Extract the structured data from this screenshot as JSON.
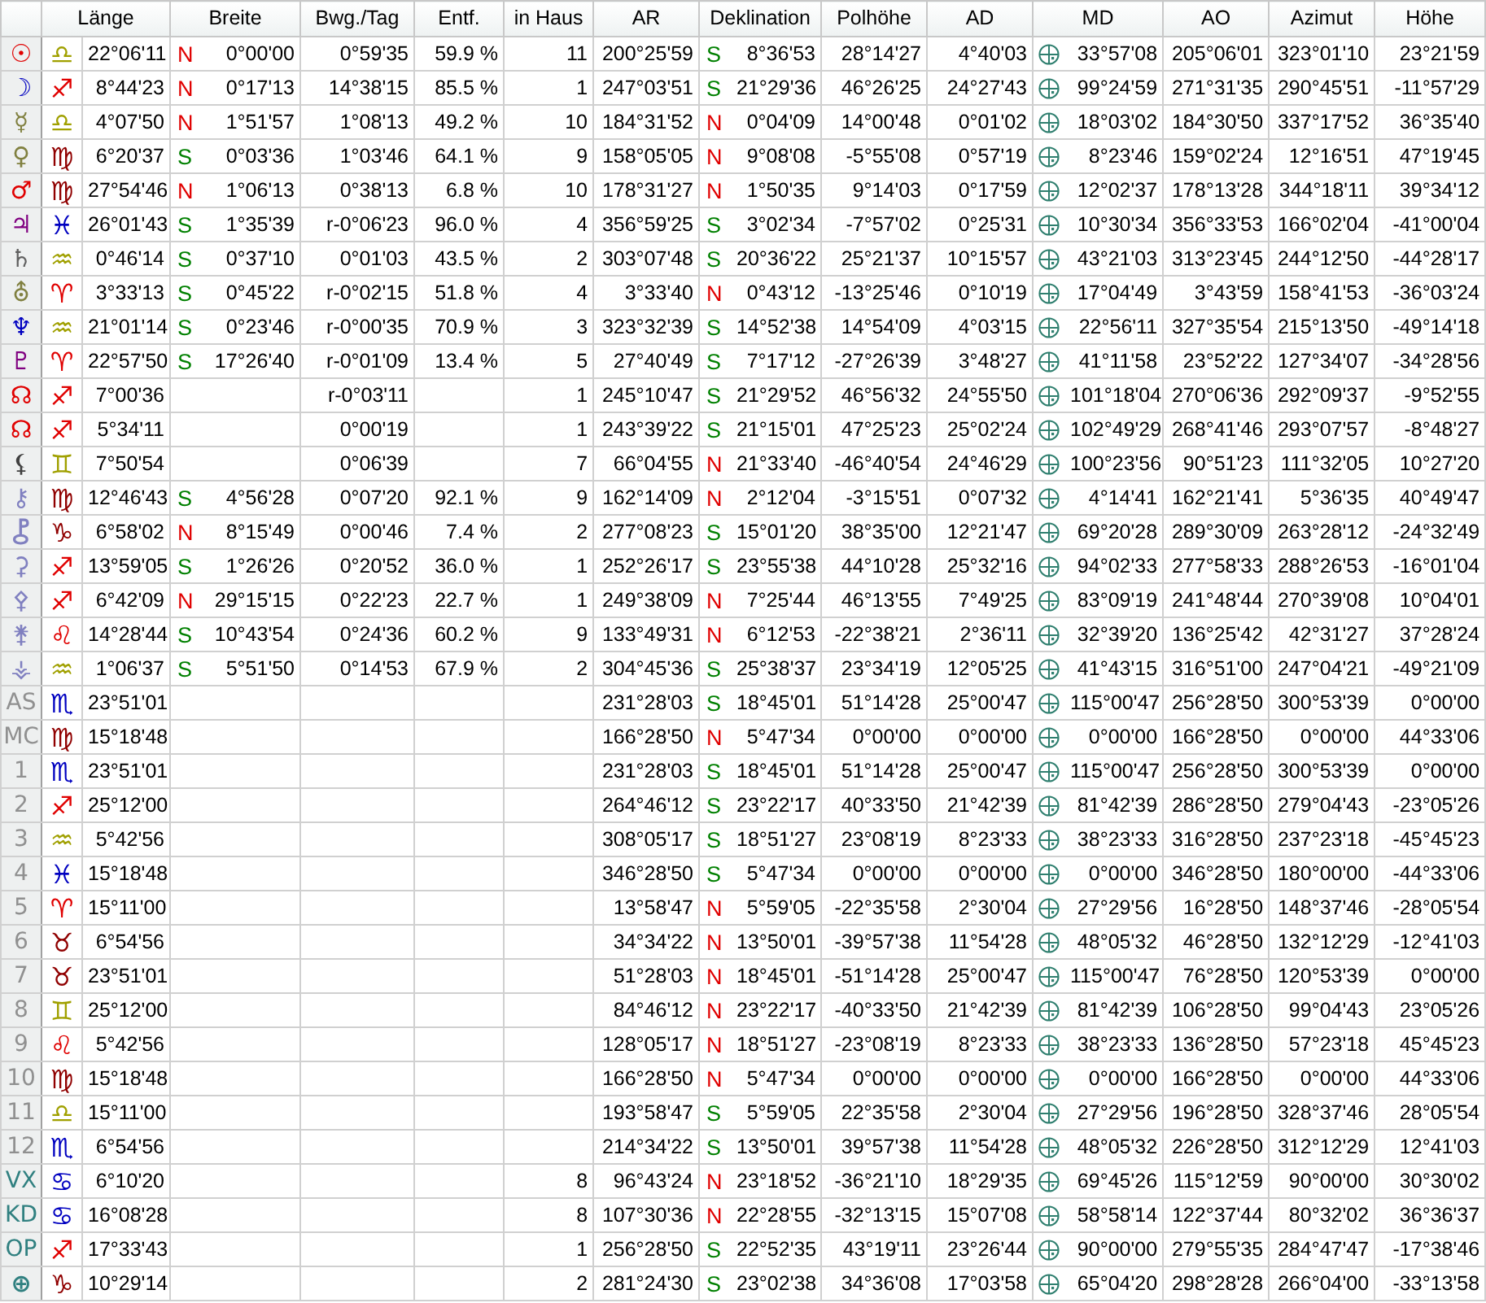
{
  "columns": [
    {
      "label": "Länge"
    },
    {
      "label": "Breite"
    },
    {
      "label": "Bwg./Tag"
    },
    {
      "label": "Entf."
    },
    {
      "label": "in Haus"
    },
    {
      "label": "AR"
    },
    {
      "label": "Deklination"
    },
    {
      "label": "Polhöhe"
    },
    {
      "label": "AD"
    },
    {
      "label": "MD"
    },
    {
      "label": "AO"
    },
    {
      "label": "Azimut"
    },
    {
      "label": "Höhe"
    }
  ],
  "rows": [
    {
      "body": {
        "text": "☉",
        "color": "#e00000"
      },
      "sign": {
        "text": "♎",
        "color": "#a0a000"
      },
      "laenge": "22°06'11",
      "breite": {
        "dir": "N",
        "color": "#e00000",
        "value": "0°00'00"
      },
      "bwg": "0°59'35",
      "entf": "59.9 %",
      "haus": "11",
      "ar": "200°25'59",
      "dekl": {
        "dir": "S",
        "color": "#008000",
        "value": "8°36'53"
      },
      "polhoehe": "28°14'27",
      "ad": "4°40'03",
      "md": "33°57'08",
      "ao": "205°06'01",
      "azimut": "323°01'10",
      "hoehe": "23°21'59"
    },
    {
      "body": {
        "text": "☽",
        "color": "#0000c0"
      },
      "sign": {
        "text": "♐",
        "color": "#e00000"
      },
      "laenge": "8°44'23",
      "breite": {
        "dir": "N",
        "color": "#e00000",
        "value": "0°17'13"
      },
      "bwg": "14°38'15",
      "entf": "85.5 %",
      "haus": "1",
      "ar": "247°03'51",
      "dekl": {
        "dir": "S",
        "color": "#008000",
        "value": "21°29'36"
      },
      "polhoehe": "46°26'25",
      "ad": "24°27'43",
      "md": "99°24'59",
      "ao": "271°31'35",
      "azimut": "290°45'51",
      "hoehe": "-11°57'29"
    },
    {
      "body": {
        "text": "☿",
        "color": "#808040"
      },
      "sign": {
        "text": "♎",
        "color": "#a0a000"
      },
      "laenge": "4°07'50",
      "breite": {
        "dir": "N",
        "color": "#e00000",
        "value": "1°51'57"
      },
      "bwg": "1°08'13",
      "entf": "49.2 %",
      "haus": "10",
      "ar": "184°31'52",
      "dekl": {
        "dir": "N",
        "color": "#e00000",
        "value": "0°04'09"
      },
      "polhoehe": "14°00'48",
      "ad": "0°01'02",
      "md": "18°03'02",
      "ao": "184°30'50",
      "azimut": "337°17'52",
      "hoehe": "36°35'40"
    },
    {
      "body": {
        "text": "♀",
        "color": "#808040"
      },
      "sign": {
        "text": "♍",
        "color": "#900000"
      },
      "laenge": "6°20'37",
      "breite": {
        "dir": "S",
        "color": "#008000",
        "value": "0°03'36"
      },
      "bwg": "1°03'46",
      "entf": "64.1 %",
      "haus": "9",
      "ar": "158°05'05",
      "dekl": {
        "dir": "N",
        "color": "#e00000",
        "value": "9°08'08"
      },
      "polhoehe": "-5°55'08",
      "ad": "0°57'19",
      "md": "8°23'46",
      "ao": "159°02'24",
      "azimut": "12°16'51",
      "hoehe": "47°19'45"
    },
    {
      "body": {
        "text": "♂",
        "color": "#e00000"
      },
      "sign": {
        "text": "♍",
        "color": "#900000"
      },
      "laenge": "27°54'46",
      "breite": {
        "dir": "N",
        "color": "#e00000",
        "value": "1°06'13"
      },
      "bwg": "0°38'13",
      "entf": "6.8 %",
      "haus": "10",
      "ar": "178°31'27",
      "dekl": {
        "dir": "N",
        "color": "#e00000",
        "value": "1°50'35"
      },
      "polhoehe": "9°14'03",
      "ad": "0°17'59",
      "md": "12°02'37",
      "ao": "178°13'28",
      "azimut": "344°18'11",
      "hoehe": "39°34'12"
    },
    {
      "body": {
        "text": "♃",
        "color": "#800080"
      },
      "sign": {
        "text": "♓",
        "color": "#0000c0"
      },
      "laenge": "26°01'43",
      "breite": {
        "dir": "S",
        "color": "#008000",
        "value": "1°35'39"
      },
      "bwg": "r-0°06'23",
      "entf": "96.0 %",
      "haus": "4",
      "ar": "356°59'25",
      "dekl": {
        "dir": "S",
        "color": "#008000",
        "value": "3°02'34"
      },
      "polhoehe": "-7°57'02",
      "ad": "0°25'31",
      "md": "10°30'34",
      "ao": "356°33'53",
      "azimut": "166°02'04",
      "hoehe": "-41°00'04"
    },
    {
      "body": {
        "text": "♄",
        "color": "#606060"
      },
      "sign": {
        "text": "♒",
        "color": "#a0a000"
      },
      "laenge": "0°46'14",
      "breite": {
        "dir": "S",
        "color": "#008000",
        "value": "0°37'10"
      },
      "bwg": "0°01'03",
      "entf": "43.5 %",
      "haus": "2",
      "ar": "303°07'48",
      "dekl": {
        "dir": "S",
        "color": "#008000",
        "value": "20°36'22"
      },
      "polhoehe": "25°21'37",
      "ad": "10°15'57",
      "md": "43°21'03",
      "ao": "313°23'45",
      "azimut": "244°12'50",
      "hoehe": "-44°28'17"
    },
    {
      "body": {
        "text": "⛢",
        "color": "#808040"
      },
      "sign": {
        "text": "♈",
        "color": "#e00000"
      },
      "laenge": "3°33'13",
      "breite": {
        "dir": "S",
        "color": "#008000",
        "value": "0°45'22"
      },
      "bwg": "r-0°02'15",
      "entf": "51.8 %",
      "haus": "4",
      "ar": "3°33'40",
      "dekl": {
        "dir": "N",
        "color": "#e00000",
        "value": "0°43'12"
      },
      "polhoehe": "-13°25'46",
      "ad": "0°10'19",
      "md": "17°04'49",
      "ao": "3°43'59",
      "azimut": "158°41'53",
      "hoehe": "-36°03'24"
    },
    {
      "body": {
        "text": "♆",
        "color": "#0000c0"
      },
      "sign": {
        "text": "♒",
        "color": "#a0a000"
      },
      "laenge": "21°01'14",
      "breite": {
        "dir": "S",
        "color": "#008000",
        "value": "0°23'46"
      },
      "bwg": "r-0°00'35",
      "entf": "70.9 %",
      "haus": "3",
      "ar": "323°32'39",
      "dekl": {
        "dir": "S",
        "color": "#008000",
        "value": "14°52'38"
      },
      "polhoehe": "14°54'09",
      "ad": "4°03'15",
      "md": "22°56'11",
      "ao": "327°35'54",
      "azimut": "215°13'50",
      "hoehe": "-49°14'18"
    },
    {
      "body": {
        "text": "♇",
        "color": "#800080"
      },
      "sign": {
        "text": "♈",
        "color": "#e00000"
      },
      "laenge": "22°57'50",
      "breite": {
        "dir": "S",
        "color": "#008000",
        "value": "17°26'40"
      },
      "bwg": "r-0°01'09",
      "entf": "13.4 %",
      "haus": "5",
      "ar": "27°40'49",
      "dekl": {
        "dir": "S",
        "color": "#008000",
        "value": "7°17'12"
      },
      "polhoehe": "-27°26'39",
      "ad": "3°48'27",
      "md": "41°11'58",
      "ao": "23°52'22",
      "azimut": "127°34'07",
      "hoehe": "-34°28'56"
    },
    {
      "body": {
        "text": "☊",
        "color": "#e00000"
      },
      "sign": {
        "text": "♐",
        "color": "#e00000"
      },
      "laenge": "7°00'36",
      "bwg": "r-0°03'11",
      "haus": "1",
      "ar": "245°10'47",
      "dekl": {
        "dir": "S",
        "color": "#008000",
        "value": "21°29'52"
      },
      "polhoehe": "46°56'32",
      "ad": "24°55'50",
      "md": "101°18'04",
      "ao": "270°06'36",
      "azimut": "292°09'37",
      "hoehe": "-9°52'55"
    },
    {
      "body": {
        "text": "☊",
        "color": "#e00000"
      },
      "sign": {
        "text": "♐",
        "color": "#e00000"
      },
      "laenge": "5°34'11",
      "bwg": "0°00'19",
      "haus": "1",
      "ar": "243°39'22",
      "dekl": {
        "dir": "S",
        "color": "#008000",
        "value": "21°15'01"
      },
      "polhoehe": "47°25'23",
      "ad": "25°02'24",
      "md": "102°49'29",
      "ao": "268°41'46",
      "azimut": "293°07'57",
      "hoehe": "-8°48'27"
    },
    {
      "body": {
        "text": "⚸",
        "color": "#404040"
      },
      "sign": {
        "text": "♊",
        "color": "#a0a000"
      },
      "laenge": "7°50'54",
      "bwg": "0°06'39",
      "haus": "7",
      "ar": "66°04'55",
      "dekl": {
        "dir": "N",
        "color": "#e00000",
        "value": "21°33'40"
      },
      "polhoehe": "-46°40'54",
      "ad": "24°46'29",
      "md": "100°23'56",
      "ao": "90°51'23",
      "azimut": "111°32'05",
      "hoehe": "10°27'20"
    },
    {
      "body": {
        "text": "⚷",
        "color": "#8080c0"
      },
      "sign": {
        "text": "♍",
        "color": "#900000"
      },
      "laenge": "12°46'43",
      "breite": {
        "dir": "S",
        "color": "#008000",
        "value": "4°56'28"
      },
      "bwg": "0°07'20",
      "entf": "92.1 %",
      "haus": "9",
      "ar": "162°14'09",
      "dekl": {
        "dir": "N",
        "color": "#e00000",
        "value": "2°12'04"
      },
      "polhoehe": "-3°15'51",
      "ad": "0°07'32",
      "md": "4°14'41",
      "ao": "162°21'41",
      "azimut": "5°36'35",
      "hoehe": "40°49'47"
    },
    {
      "body": {
        "text": "⯛",
        "color": "#8080c0"
      },
      "sign": {
        "text": "♑",
        "color": "#900000"
      },
      "laenge": "6°58'02",
      "breite": {
        "dir": "N",
        "color": "#e00000",
        "value": "8°15'49"
      },
      "bwg": "0°00'46",
      "entf": "7.4 %",
      "haus": "2",
      "ar": "277°08'23",
      "dekl": {
        "dir": "S",
        "color": "#008000",
        "value": "15°01'20"
      },
      "polhoehe": "38°35'00",
      "ad": "12°21'47",
      "md": "69°20'28",
      "ao": "289°30'09",
      "azimut": "263°28'12",
      "hoehe": "-24°32'49"
    },
    {
      "body": {
        "text": "⚳",
        "color": "#8080c0"
      },
      "sign": {
        "text": "♐",
        "color": "#e00000"
      },
      "laenge": "13°59'05",
      "breite": {
        "dir": "S",
        "color": "#008000",
        "value": "1°26'26"
      },
      "bwg": "0°20'52",
      "entf": "36.0 %",
      "haus": "1",
      "ar": "252°26'17",
      "dekl": {
        "dir": "S",
        "color": "#008000",
        "value": "23°55'38"
      },
      "polhoehe": "44°10'28",
      "ad": "25°32'16",
      "md": "94°02'33",
      "ao": "277°58'33",
      "azimut": "288°26'53",
      "hoehe": "-16°01'04"
    },
    {
      "body": {
        "text": "⚴",
        "color": "#8080c0"
      },
      "sign": {
        "text": "♐",
        "color": "#e00000"
      },
      "laenge": "6°42'09",
      "breite": {
        "dir": "N",
        "color": "#e00000",
        "value": "29°15'15"
      },
      "bwg": "0°22'23",
      "entf": "22.7 %",
      "haus": "1",
      "ar": "249°38'09",
      "dekl": {
        "dir": "N",
        "color": "#e00000",
        "value": "7°25'44"
      },
      "polhoehe": "46°13'55",
      "ad": "7°49'25",
      "md": "83°09'19",
      "ao": "241°48'44",
      "azimut": "270°39'08",
      "hoehe": "10°04'01"
    },
    {
      "body": {
        "text": "⚵",
        "color": "#8080c0"
      },
      "sign": {
        "text": "♌",
        "color": "#e00000"
      },
      "laenge": "14°28'44",
      "breite": {
        "dir": "S",
        "color": "#008000",
        "value": "10°43'54"
      },
      "bwg": "0°24'36",
      "entf": "60.2 %",
      "haus": "9",
      "ar": "133°49'31",
      "dekl": {
        "dir": "N",
        "color": "#e00000",
        "value": "6°12'53"
      },
      "polhoehe": "-22°38'21",
      "ad": "2°36'11",
      "md": "32°39'20",
      "ao": "136°25'42",
      "azimut": "42°31'27",
      "hoehe": "37°28'24"
    },
    {
      "body": {
        "text": "⚶",
        "color": "#8080c0"
      },
      "sign": {
        "text": "♒",
        "color": "#a0a000"
      },
      "laenge": "1°06'37",
      "breite": {
        "dir": "S",
        "color": "#008000",
        "value": "5°51'50"
      },
      "bwg": "0°14'53",
      "entf": "67.9 %",
      "haus": "2",
      "ar": "304°45'36",
      "dekl": {
        "dir": "S",
        "color": "#008000",
        "value": "25°38'37"
      },
      "polhoehe": "23°34'19",
      "ad": "12°05'25",
      "md": "41°43'15",
      "ao": "316°51'00",
      "azimut": "247°04'21",
      "hoehe": "-49°21'09"
    },
    {
      "body": {
        "text": "AS",
        "color": "#909090"
      },
      "sign": {
        "text": "♏",
        "color": "#0000c0"
      },
      "laenge": "23°51'01",
      "ar": "231°28'03",
      "dekl": {
        "dir": "S",
        "color": "#008000",
        "value": "18°45'01"
      },
      "polhoehe": "51°14'28",
      "ad": "25°00'47",
      "md": "115°00'47",
      "ao": "256°28'50",
      "azimut": "300°53'39",
      "hoehe": "0°00'00"
    },
    {
      "body": {
        "text": "MC",
        "color": "#909090"
      },
      "sign": {
        "text": "♍",
        "color": "#900000"
      },
      "laenge": "15°18'48",
      "ar": "166°28'50",
      "dekl": {
        "dir": "N",
        "color": "#e00000",
        "value": "5°47'34"
      },
      "polhoehe": "0°00'00",
      "ad": "0°00'00",
      "md": "0°00'00",
      "ao": "166°28'50",
      "azimut": "0°00'00",
      "hoehe": "44°33'06"
    },
    {
      "body": {
        "text": "1",
        "color": "#909090"
      },
      "sign": {
        "text": "♏",
        "color": "#0000c0"
      },
      "laenge": "23°51'01",
      "ar": "231°28'03",
      "dekl": {
        "dir": "S",
        "color": "#008000",
        "value": "18°45'01"
      },
      "polhoehe": "51°14'28",
      "ad": "25°00'47",
      "md": "115°00'47",
      "ao": "256°28'50",
      "azimut": "300°53'39",
      "hoehe": "0°00'00"
    },
    {
      "body": {
        "text": "2",
        "color": "#909090"
      },
      "sign": {
        "text": "♐",
        "color": "#e00000"
      },
      "laenge": "25°12'00",
      "ar": "264°46'12",
      "dekl": {
        "dir": "S",
        "color": "#008000",
        "value": "23°22'17"
      },
      "polhoehe": "40°33'50",
      "ad": "21°42'39",
      "md": "81°42'39",
      "ao": "286°28'50",
      "azimut": "279°04'43",
      "hoehe": "-23°05'26"
    },
    {
      "body": {
        "text": "3",
        "color": "#909090"
      },
      "sign": {
        "text": "♒",
        "color": "#a0a000"
      },
      "laenge": "5°42'56",
      "ar": "308°05'17",
      "dekl": {
        "dir": "S",
        "color": "#008000",
        "value": "18°51'27"
      },
      "polhoehe": "23°08'19",
      "ad": "8°23'33",
      "md": "38°23'33",
      "ao": "316°28'50",
      "azimut": "237°23'18",
      "hoehe": "-45°45'23"
    },
    {
      "body": {
        "text": "4",
        "color": "#909090"
      },
      "sign": {
        "text": "♓",
        "color": "#0000c0"
      },
      "laenge": "15°18'48",
      "ar": "346°28'50",
      "dekl": {
        "dir": "S",
        "color": "#008000",
        "value": "5°47'34"
      },
      "polhoehe": "0°00'00",
      "ad": "0°00'00",
      "md": "0°00'00",
      "ao": "346°28'50",
      "azimut": "180°00'00",
      "hoehe": "-44°33'06"
    },
    {
      "body": {
        "text": "5",
        "color": "#909090"
      },
      "sign": {
        "text": "♈",
        "color": "#e00000"
      },
      "laenge": "15°11'00",
      "ar": "13°58'47",
      "dekl": {
        "dir": "N",
        "color": "#e00000",
        "value": "5°59'05"
      },
      "polhoehe": "-22°35'58",
      "ad": "2°30'04",
      "md": "27°29'56",
      "ao": "16°28'50",
      "azimut": "148°37'46",
      "hoehe": "-28°05'54"
    },
    {
      "body": {
        "text": "6",
        "color": "#909090"
      },
      "sign": {
        "text": "♉",
        "color": "#900000"
      },
      "laenge": "6°54'56",
      "ar": "34°34'22",
      "dekl": {
        "dir": "N",
        "color": "#e00000",
        "value": "13°50'01"
      },
      "polhoehe": "-39°57'38",
      "ad": "11°54'28",
      "md": "48°05'32",
      "ao": "46°28'50",
      "azimut": "132°12'29",
      "hoehe": "-12°41'03"
    },
    {
      "body": {
        "text": "7",
        "color": "#909090"
      },
      "sign": {
        "text": "♉",
        "color": "#900000"
      },
      "laenge": "23°51'01",
      "ar": "51°28'03",
      "dekl": {
        "dir": "N",
        "color": "#e00000",
        "value": "18°45'01"
      },
      "polhoehe": "-51°14'28",
      "ad": "25°00'47",
      "md": "115°00'47",
      "ao": "76°28'50",
      "azimut": "120°53'39",
      "hoehe": "0°00'00"
    },
    {
      "body": {
        "text": "8",
        "color": "#909090"
      },
      "sign": {
        "text": "♊",
        "color": "#a0a000"
      },
      "laenge": "25°12'00",
      "ar": "84°46'12",
      "dekl": {
        "dir": "N",
        "color": "#e00000",
        "value": "23°22'17"
      },
      "polhoehe": "-40°33'50",
      "ad": "21°42'39",
      "md": "81°42'39",
      "ao": "106°28'50",
      "azimut": "99°04'43",
      "hoehe": "23°05'26"
    },
    {
      "body": {
        "text": "9",
        "color": "#909090"
      },
      "sign": {
        "text": "♌",
        "color": "#e00000"
      },
      "laenge": "5°42'56",
      "ar": "128°05'17",
      "dekl": {
        "dir": "N",
        "color": "#e00000",
        "value": "18°51'27"
      },
      "polhoehe": "-23°08'19",
      "ad": "8°23'33",
      "md": "38°23'33",
      "ao": "136°28'50",
      "azimut": "57°23'18",
      "hoehe": "45°45'23"
    },
    {
      "body": {
        "text": "10",
        "color": "#909090"
      },
      "sign": {
        "text": "♍",
        "color": "#900000"
      },
      "laenge": "15°18'48",
      "ar": "166°28'50",
      "dekl": {
        "dir": "N",
        "color": "#e00000",
        "value": "5°47'34"
      },
      "polhoehe": "0°00'00",
      "ad": "0°00'00",
      "md": "0°00'00",
      "ao": "166°28'50",
      "azimut": "0°00'00",
      "hoehe": "44°33'06"
    },
    {
      "body": {
        "text": "11",
        "color": "#909090"
      },
      "sign": {
        "text": "♎",
        "color": "#a0a000"
      },
      "laenge": "15°11'00",
      "ar": "193°58'47",
      "dekl": {
        "dir": "S",
        "color": "#008000",
        "value": "5°59'05"
      },
      "polhoehe": "22°35'58",
      "ad": "2°30'04",
      "md": "27°29'56",
      "ao": "196°28'50",
      "azimut": "328°37'46",
      "hoehe": "28°05'54"
    },
    {
      "body": {
        "text": "12",
        "color": "#909090"
      },
      "sign": {
        "text": "♏",
        "color": "#0000c0"
      },
      "laenge": "6°54'56",
      "ar": "214°34'22",
      "dekl": {
        "dir": "S",
        "color": "#008000",
        "value": "13°50'01"
      },
      "polhoehe": "39°57'38",
      "ad": "11°54'28",
      "md": "48°05'32",
      "ao": "226°28'50",
      "azimut": "312°12'29",
      "hoehe": "12°41'03"
    },
    {
      "body": {
        "text": "VX",
        "color": "#308080"
      },
      "sign": {
        "text": "♋",
        "color": "#0000c0"
      },
      "laenge": "6°10'20",
      "haus": "8",
      "ar": "96°43'24",
      "dekl": {
        "dir": "N",
        "color": "#e00000",
        "value": "23°18'52"
      },
      "polhoehe": "-36°21'10",
      "ad": "18°29'35",
      "md": "69°45'26",
      "ao": "115°12'59",
      "azimut": "90°00'00",
      "hoehe": "30°30'02"
    },
    {
      "body": {
        "text": "KD",
        "color": "#308080"
      },
      "sign": {
        "text": "♋",
        "color": "#0000c0"
      },
      "laenge": "16°08'28",
      "haus": "8",
      "ar": "107°30'36",
      "dekl": {
        "dir": "N",
        "color": "#e00000",
        "value": "22°28'55"
      },
      "polhoehe": "-32°13'15",
      "ad": "15°07'08",
      "md": "58°58'14",
      "ao": "122°37'44",
      "azimut": "80°32'02",
      "hoehe": "36°36'37"
    },
    {
      "body": {
        "text": "OP",
        "color": "#308080"
      },
      "sign": {
        "text": "♐",
        "color": "#e00000"
      },
      "laenge": "17°33'43",
      "haus": "1",
      "ar": "256°28'50",
      "dekl": {
        "dir": "S",
        "color": "#008000",
        "value": "22°52'35"
      },
      "polhoehe": "43°19'11",
      "ad": "23°26'44",
      "md": "90°00'00",
      "ao": "279°55'35",
      "azimut": "284°47'47",
      "hoehe": "-17°38'46"
    },
    {
      "body": {
        "text": "⊕",
        "color": "#308080"
      },
      "sign": {
        "text": "♑",
        "color": "#900000"
      },
      "laenge": "10°29'14",
      "haus": "2",
      "ar": "281°24'30",
      "dekl": {
        "dir": "S",
        "color": "#008000",
        "value": "23°02'38"
      },
      "polhoehe": "34°36'08",
      "ad": "17°03'58",
      "md": "65°04'20",
      "ao": "298°28'28",
      "azimut": "266°04'00",
      "hoehe": "-33°13'58"
    }
  ]
}
